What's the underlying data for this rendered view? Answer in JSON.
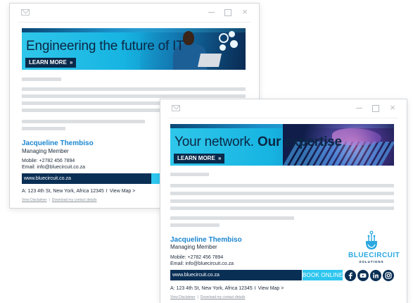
{
  "windows": [
    {
      "banner_text": "Engineering the future of IT",
      "learn_more": "LEARN MORE",
      "chevron": "»",
      "name": "Jacqueline Thembiso",
      "title": "Managing Member",
      "mobile": "Mobile: +2782 456 7894",
      "email": "Email: info@bluecircuit.co.za",
      "website": "www.bluecircuit.co.za",
      "address": "A: 123 4th St, New York, Africa 12345",
      "address_sep": "I",
      "view_map": "View Map >",
      "disclaimer": "View Disclaimer",
      "links_sep": "|",
      "download": "Download my contact details"
    },
    {
      "banner_text_regular": "Your network.",
      "banner_text_bold": "Our expertise",
      "learn_more": "LEARN MORE",
      "chevron": "»",
      "name": "Jacqueline Thembiso",
      "title": "Managing Member",
      "mobile": "Mobile: +2782 456 7894",
      "email": "Email: info@bluecircuit.co.za",
      "website": "www.bluecircuit.co.za",
      "book_online": "BOOK ONLINE »",
      "address": "A: 123 4th St, New York, Africa 12345",
      "address_sep": "I",
      "view_map": "View Map >",
      "disclaimer": "View Disclaimer",
      "links_sep": "|",
      "download": "Download my contact details",
      "logo_name": "BLUECIRCUIT",
      "logo_sub": "SOLUTIONS",
      "social_icons": [
        "facebook-icon",
        "youtube-icon",
        "linkedin-icon",
        "instagram-icon"
      ]
    }
  ],
  "window_controls": {
    "minimize": "minimize-icon",
    "maximize": "maximize-icon",
    "close": "×"
  },
  "colors": {
    "accent_blue": "#2ec6ef",
    "navy": "#0a2f55",
    "name_blue": "#1a86d0",
    "placeholder_gray": "#dcdfe2"
  }
}
